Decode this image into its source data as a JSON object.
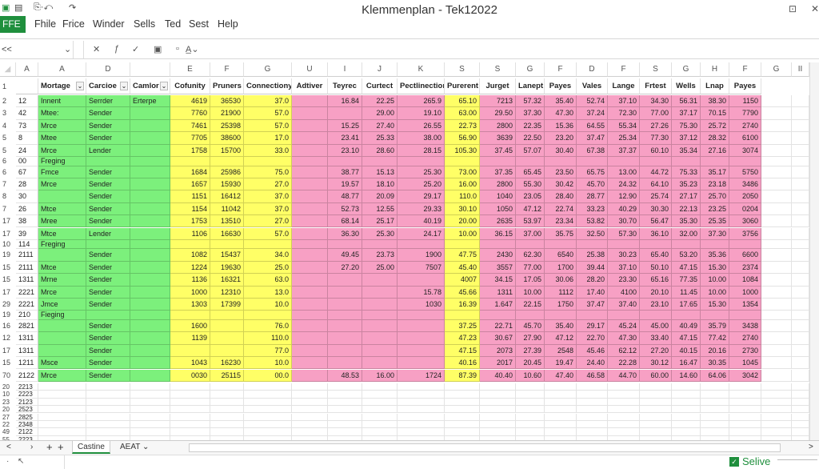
{
  "window": {
    "title": "Klemmenplan - Tek12022",
    "quick_access": [
      "save-icon",
      "grid-icon",
      "undo-icon",
      "redo-icon"
    ],
    "restore_label": "⊡",
    "close_label": "✕"
  },
  "menu": {
    "file_tab": "FFE",
    "items": [
      "Fhile",
      "Frice",
      "Winder",
      "Sells",
      "Ted",
      "Sest",
      "Help"
    ]
  },
  "toolbar": {
    "name_box": "<<",
    "icons": [
      "cancel-icon",
      "function-icon",
      "confirm-icon",
      "paste-icon",
      "format-icon",
      "font-color-icon"
    ]
  },
  "columns": [
    "A",
    "A",
    "D",
    "",
    "E",
    "F",
    "G",
    "U",
    "I",
    "J",
    "K",
    "S",
    "S",
    "G",
    "F",
    "D",
    "F",
    "S",
    "G",
    "H",
    "F",
    "G",
    "II"
  ],
  "headers": [
    "",
    "Mortage",
    "Carcioe",
    "Camlor",
    "Cofunity",
    "Pruners",
    "Connectiony",
    "Adtiver",
    "Teyrec",
    "Curtect",
    "Pectlinection",
    "Purerent",
    "Jurget",
    "Lanept",
    "Payes",
    "Vales",
    "Lange",
    "Frtest",
    "Wells",
    "Lnap",
    "Payes"
  ],
  "rows": [
    {
      "rn": "2",
      "id": "12",
      "c": [
        "Innent",
        "Serrder",
        "Erterpe",
        "4619",
        "36530",
        "37.0",
        "",
        "16.84",
        "22.25",
        "265.9",
        "65.10",
        "7213",
        "57.32",
        "35.40",
        "52.74",
        "37.10",
        "34.30",
        "56.31",
        "38.30",
        "1150"
      ]
    },
    {
      "rn": "3",
      "id": "42",
      "c": [
        "Mtee:",
        "Sender",
        "",
        "7760",
        "21900",
        "57.0",
        "",
        "",
        "29.00",
        "19.10",
        "63.00",
        "29.50",
        "37.30",
        "47.30",
        "37.24",
        "72.30",
        "77.00",
        "37.17",
        "70.15",
        "7790"
      ]
    },
    {
      "rn": "4",
      "id": "73",
      "c": [
        "Mrce",
        "Sender",
        "",
        "7461",
        "25398",
        "57.0",
        "",
        "15.25",
        "27.40",
        "26.55",
        "22.73",
        "2800",
        "22.35",
        "15.36",
        "64.55",
        "55.34",
        "27.26",
        "75.30",
        "25.72",
        "2740"
      ]
    },
    {
      "rn": "5",
      "id": "8",
      "c": [
        "Mtee",
        "Sender",
        "",
        "7705",
        "38600",
        "17.0",
        "",
        "23.41",
        "25.33",
        "38.00",
        "56.90",
        "3639",
        "22.50",
        "23.20",
        "37.47",
        "25.34",
        "77.30",
        "37.12",
        "28.32",
        "6100"
      ]
    },
    {
      "rn": "5",
      "id": "24",
      "c": [
        "Mrce",
        "Lender",
        "",
        "1758",
        "15700",
        "33.0",
        "",
        "23.10",
        "28.60",
        "28.15",
        "105.30",
        "37.45",
        "57.07",
        "30.40",
        "67.38",
        "37.37",
        "60.10",
        "35.34",
        "27.16",
        "3074"
      ]
    },
    {
      "rn": "6",
      "id": "00",
      "group": "Freging"
    },
    {
      "rn": "6",
      "id": "67",
      "c": [
        "Fmce",
        "Sender",
        "",
        "1684",
        "25986",
        "75.0",
        "",
        "38.77",
        "15.13",
        "25.30",
        "73.00",
        "37.35",
        "65.45",
        "23.50",
        "65.75",
        "13.00",
        "44.72",
        "75.33",
        "35.17",
        "5750"
      ]
    },
    {
      "rn": "7",
      "id": "28",
      "c": [
        "Mrce",
        "Sender",
        "",
        "1657",
        "15930",
        "27.0",
        "",
        "19.57",
        "18.10",
        "25.20",
        "16.00",
        "2800",
        "55.30",
        "30.42",
        "45.70",
        "24.32",
        "64.10",
        "35.23",
        "23.18",
        "3486"
      ]
    },
    {
      "rn": "8",
      "id": "30",
      "c": [
        "",
        "Sender",
        "",
        "1151",
        "16412",
        "37.0",
        "",
        "48.77",
        "20.09",
        "29.17",
        "110.0",
        "1040",
        "23.05",
        "28.40",
        "28.77",
        "12.90",
        "25.74",
        "27.17",
        "25.70",
        "2050"
      ]
    },
    {
      "rn": "7",
      "id": "26",
      "c": [
        "Mtce",
        "Sender",
        "",
        "1154",
        "11042",
        "37.0",
        "",
        "52.73",
        "12.55",
        "29.33",
        "30.10",
        "1050",
        "47.12",
        "22.74",
        "33.23",
        "40.29",
        "30.30",
        "22.13",
        "23.25",
        "0204"
      ]
    },
    {
      "rn": "17",
      "id": "38",
      "c": [
        "Mree",
        "Sender",
        "",
        "1753",
        "13510",
        "27.0",
        "",
        "68.14",
        "25.17",
        "40.19",
        "20.00",
        "2635",
        "53.97",
        "23.34",
        "53.82",
        "30.70",
        "56.47",
        "35.30",
        "25.35",
        "3060"
      ]
    },
    {
      "rn": "17",
      "id": "39",
      "c": [
        "Mtce",
        "Lender",
        "",
        "1106",
        "16630",
        "57.0",
        "",
        "36.30",
        "25.30",
        "24.17",
        "10.00",
        "36.15",
        "37.00",
        "35.75",
        "32.50",
        "57.30",
        "36.10",
        "32.00",
        "37.30",
        "3756"
      ]
    },
    {
      "rn": "10",
      "id": "114",
      "group": "Freging"
    },
    {
      "rn": "19",
      "id": "2111",
      "c": [
        "",
        "Sender",
        "",
        "1082",
        "15437",
        "34.0",
        "",
        "49.45",
        "23.73",
        "1900",
        "47.75",
        "2430",
        "62.30",
        "6540",
        "25.38",
        "30.23",
        "65.40",
        "53.20",
        "35.36",
        "6600"
      ]
    },
    {
      "rn": "15",
      "id": "2111",
      "c": [
        "Mtce",
        "Sender",
        "",
        "1224",
        "19630",
        "25.0",
        "",
        "27.20",
        "25.00",
        "7507",
        "45.40",
        "3557",
        "77.00",
        "1700",
        "39.44",
        "37.10",
        "50.10",
        "47.15",
        "15.30",
        "2374"
      ]
    },
    {
      "rn": "15",
      "id": "1311",
      "c": [
        "Mrne",
        "Sender",
        "",
        "1136",
        "16321",
        "63.0",
        "",
        "",
        "",
        "",
        "4007",
        "34.15",
        "17.05",
        "30.06",
        "28.20",
        "23.30",
        "65.16",
        "77.35",
        "10.00",
        "1084"
      ]
    },
    {
      "rn": "17",
      "id": "2221",
      "c": [
        "Mrce",
        "Sender",
        "",
        "1000",
        "12310",
        "13.0",
        "",
        "",
        "",
        "15.78",
        "45.66",
        "1311",
        "10.00",
        "1112",
        "17.40",
        "4100",
        "20.10",
        "11.45",
        "10.00",
        "1000"
      ]
    },
    {
      "rn": "29",
      "id": "2221",
      "c": [
        "Jmce",
        "Sender",
        "",
        "1303",
        "17399",
        "10.0",
        "",
        "",
        "",
        "1030",
        "16.39",
        "1.647",
        "22.15",
        "1750",
        "37.47",
        "37.40",
        "23.10",
        "17.65",
        "15.30",
        "1354"
      ]
    },
    {
      "rn": "19",
      "id": "210",
      "group": "Fieging"
    },
    {
      "rn": "16",
      "id": "2821",
      "c": [
        "",
        "Sender",
        "",
        "1600",
        "",
        "76.0",
        "",
        "",
        "",
        "",
        "37.25",
        "22.71",
        "45.70",
        "35.40",
        "29.17",
        "45.24",
        "45.00",
        "40.49",
        "35.79",
        "3438"
      ]
    },
    {
      "rn": "12",
      "id": "1311",
      "c": [
        "",
        "Sender",
        "",
        "1139",
        "",
        "110.0",
        "",
        "",
        "",
        "",
        "47.23",
        "30.67",
        "27.90",
        "47.12",
        "22.70",
        "47.30",
        "33.40",
        "47.15",
        "77.42",
        "2740"
      ]
    },
    {
      "rn": "17",
      "id": "1311",
      "c": [
        "",
        "Sender",
        "",
        "",
        "",
        "77.0",
        "",
        "",
        "",
        "",
        "47.15",
        "2073",
        "27.39",
        "2548",
        "45.46",
        "62.12",
        "27.20",
        "40.15",
        "20.16",
        "2730"
      ]
    },
    {
      "rn": "15",
      "id": "1211",
      "c": [
        "Msce",
        "Sender",
        "",
        "1043",
        "16230",
        "10.0",
        "",
        "",
        "",
        "",
        "40.16",
        "2017",
        "20.45",
        "19.47",
        "24.40",
        "22.28",
        "30.12",
        "16.47",
        "30.35",
        "1045"
      ]
    },
    {
      "rn": "70",
      "id": "2122",
      "c": [
        "Mrce",
        "Sender",
        "",
        "0030",
        "25115",
        "00.0",
        "",
        "48.53",
        "16.00",
        "1724",
        "87.39",
        "40.40",
        "10.60",
        "47.40",
        "46.58",
        "44.70",
        "60.00",
        "14.60",
        "64.06",
        "3042"
      ]
    }
  ],
  "empty_rows": [
    {
      "rn": "20",
      "id": "2213"
    },
    {
      "rn": "10",
      "id": "2223"
    },
    {
      "rn": "23",
      "id": "2123"
    },
    {
      "rn": "20",
      "id": "2523"
    },
    {
      "rn": "27",
      "id": "2825"
    },
    {
      "rn": "22",
      "id": "2348"
    },
    {
      "rn": "49",
      "id": "2122"
    },
    {
      "rn": "55",
      "id": "2223"
    },
    {
      "rn": "35",
      "id": "2233"
    },
    {
      "rn": "53",
      "id": "2611"
    }
  ],
  "sheet_tabs": {
    "prev_label": "<",
    "next_label": "›",
    "add_label": "+",
    "add_alt_label": "+",
    "active": "Castine",
    "other": "AEAT ⌄"
  },
  "status": {
    "left_icons": [
      "ready-icon",
      "macro-icon"
    ],
    "mode_label": "Selive",
    "zoom_slider": "—————",
    "scroll_right_label": ">"
  },
  "colors": {
    "accent": "#1f8f3d",
    "green_fill": "#7cf07c",
    "yellow_fill": "#ffff66",
    "pink_fill": "#f7a0c4"
  }
}
